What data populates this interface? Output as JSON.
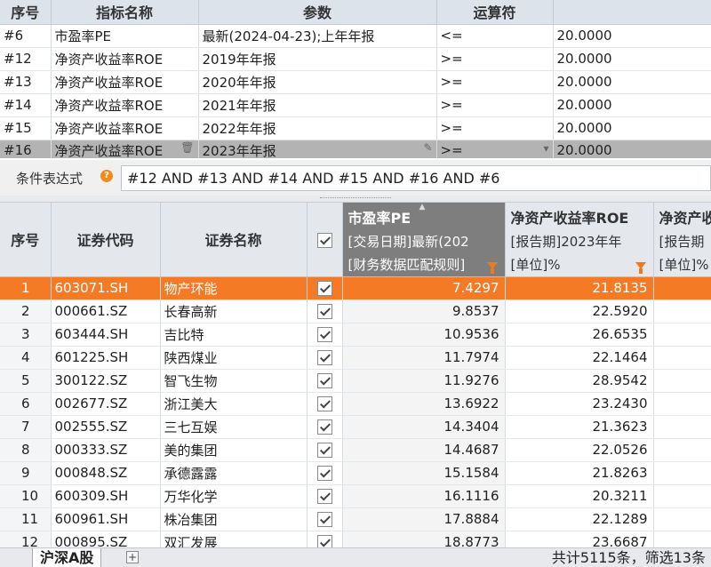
{
  "conditions": {
    "headers": [
      "序号",
      "指标名称",
      "参数",
      "运算符",
      ""
    ],
    "rows": [
      {
        "id": "#6",
        "name": "市盈率PE",
        "param": "最新(2024-04-23);上年年报",
        "op": "<=",
        "value": "20.0000"
      },
      {
        "id": "#12",
        "name": "净资产收益率ROE",
        "param": "2019年年报",
        "op": ">=",
        "value": "20.0000"
      },
      {
        "id": "#13",
        "name": "净资产收益率ROE",
        "param": "2020年年报",
        "op": ">=",
        "value": "20.0000"
      },
      {
        "id": "#14",
        "name": "净资产收益率ROE",
        "param": "2021年年报",
        "op": ">=",
        "value": "20.0000"
      },
      {
        "id": "#15",
        "name": "净资产收益率ROE",
        "param": "2022年年报",
        "op": ">=",
        "value": "20.0000"
      },
      {
        "id": "#16",
        "name": "净资产收益率ROE",
        "param": "2023年年报",
        "op": ">=",
        "value": "20.0000"
      }
    ]
  },
  "expression": {
    "label": "条件表达式",
    "help": "?",
    "value": "#12 AND #13 AND #14 AND #15 AND #16 AND #6"
  },
  "grid": {
    "headers": {
      "idx": "序号",
      "code": "证券代码",
      "name": "证券名称",
      "pe": {
        "title": "市盈率PE",
        "line1": "[交易日期]最新(202",
        "line2": "[财务数据匹配规则]"
      },
      "roe1": {
        "title": "净资产收益率ROE",
        "line1": "[报告期]2023年年",
        "line2": "[单位]%"
      },
      "roe2": {
        "title": "净资产收益率",
        "line1": "[报告期",
        "line2": "[单位]%"
      }
    },
    "rows": [
      {
        "idx": "1",
        "code": "603071.SH",
        "name": "物产环能",
        "pe": "7.4297",
        "roe": "21.8135"
      },
      {
        "idx": "2",
        "code": "000661.SZ",
        "name": "长春高新",
        "pe": "9.8537",
        "roe": "22.5920"
      },
      {
        "idx": "3",
        "code": "603444.SH",
        "name": "吉比特",
        "pe": "10.9536",
        "roe": "26.6535"
      },
      {
        "idx": "4",
        "code": "601225.SH",
        "name": "陕西煤业",
        "pe": "11.7974",
        "roe": "22.1464"
      },
      {
        "idx": "5",
        "code": "300122.SZ",
        "name": "智飞生物",
        "pe": "11.9276",
        "roe": "28.9542"
      },
      {
        "idx": "6",
        "code": "002677.SZ",
        "name": "浙江美大",
        "pe": "13.6922",
        "roe": "23.2430"
      },
      {
        "idx": "7",
        "code": "002555.SZ",
        "name": "三七互娱",
        "pe": "14.3404",
        "roe": "21.3623"
      },
      {
        "idx": "8",
        "code": "000333.SZ",
        "name": "美的集团",
        "pe": "14.4687",
        "roe": "22.0526"
      },
      {
        "idx": "9",
        "code": "000848.SZ",
        "name": "承德露露",
        "pe": "15.1584",
        "roe": "21.8263"
      },
      {
        "idx": "10",
        "code": "600309.SH",
        "name": "万华化学",
        "pe": "16.1116",
        "roe": "20.3211"
      },
      {
        "idx": "11",
        "code": "600961.SH",
        "name": "株冶集团",
        "pe": "17.8884",
        "roe": "22.1289"
      },
      {
        "idx": "12",
        "code": "000895.SZ",
        "name": "双汇发展",
        "pe": "18.8773",
        "roe": "23.6687"
      }
    ]
  },
  "footer": {
    "tab": "沪深A股",
    "add": "+",
    "status": "共计5115条，筛选13条"
  },
  "colors": {
    "active_row": "#f47a26",
    "highlight_header": "#7e7e7e",
    "filter_icon": "#f07a1a"
  }
}
